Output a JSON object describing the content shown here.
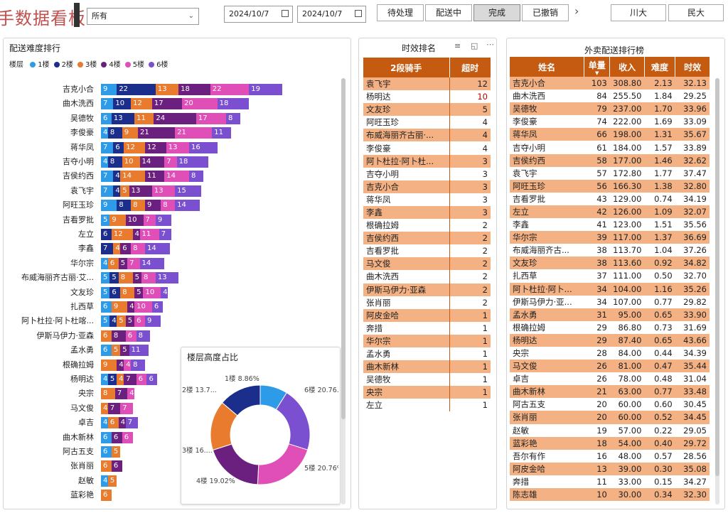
{
  "header": {
    "title": "手数据看板",
    "filter_value": "所有",
    "date_start": "2024/10/7",
    "date_end": "2024/10/7",
    "status_tabs": [
      "待处理",
      "配送中",
      "完成",
      "已撤销"
    ],
    "active_status": "完成",
    "region_tabs": [
      "川大",
      "民大"
    ]
  },
  "difficulty_panel": {
    "title": "配送难度排行",
    "legend_label": "楼层",
    "floors": [
      "1楼",
      "2楼",
      "3楼",
      "4楼",
      "5楼",
      "6楼"
    ],
    "colors": [
      "#2e9be8",
      "#1c2e8c",
      "#e87b2e",
      "#6b1f7e",
      "#e04fb8",
      "#7b50d0"
    ]
  },
  "chart_data": [
    {
      "type": "bar",
      "title": "配送难度排行",
      "stacked": true,
      "orientation": "horizontal",
      "categories": [
        "吉克小合",
        "曲木洗西",
        "吴德牧",
        "李俊豪",
        "蒋华凤",
        "吉夺小明",
        "吉侯约西",
        "袁飞宇",
        "阿旺玉珍",
        "吉看罗批",
        "左立",
        "李鑫",
        "华尔宗",
        "布威海丽齐古丽·艾...",
        "文友珍",
        "扎西草",
        "阿卜杜拉·阿卜杜喀...",
        "伊斯马伊力·亚森",
        "孟水勇",
        "根确拉姆",
        "杨明达",
        "央宗",
        "马文俊",
        "卓吉",
        "曲木新林",
        "阿古五支",
        "张肖丽",
        "赵敏",
        "蓝彩艳"
      ],
      "series": [
        {
          "name": "1楼",
          "values": [
            9,
            7,
            6,
            4,
            7,
            4,
            7,
            7,
            9,
            5,
            0,
            0,
            4,
            5,
            5,
            6,
            5,
            0,
            6,
            0,
            4,
            0,
            0,
            4,
            6,
            6,
            0,
            4,
            0
          ]
        },
        {
          "name": "2楼",
          "values": [
            22,
            10,
            13,
            8,
            6,
            8,
            4,
            4,
            8,
            0,
            6,
            7,
            0,
            5,
            6,
            0,
            4,
            0,
            0,
            0,
            5,
            0,
            0,
            0,
            0,
            0,
            0,
            0,
            0
          ]
        },
        {
          "name": "3楼",
          "values": [
            13,
            12,
            11,
            9,
            12,
            10,
            14,
            5,
            8,
            9,
            12,
            4,
            6,
            8,
            8,
            9,
            5,
            6,
            5,
            9,
            4,
            8,
            4,
            6,
            0,
            5,
            6,
            5,
            6
          ]
        },
        {
          "name": "4楼",
          "values": [
            18,
            17,
            24,
            21,
            12,
            14,
            11,
            13,
            9,
            10,
            4,
            6,
            5,
            5,
            5,
            4,
            5,
            8,
            5,
            4,
            7,
            7,
            7,
            4,
            6,
            0,
            6,
            0,
            0
          ]
        },
        {
          "name": "5楼",
          "values": [
            22,
            20,
            17,
            21,
            13,
            7,
            14,
            13,
            8,
            7,
            11,
            8,
            7,
            8,
            10,
            10,
            6,
            6,
            0,
            4,
            6,
            4,
            7,
            0,
            6,
            0,
            0,
            0,
            0
          ]
        },
        {
          "name": "6楼",
          "values": [
            19,
            18,
            8,
            11,
            16,
            18,
            8,
            15,
            14,
            9,
            7,
            14,
            14,
            13,
            4,
            6,
            9,
            8,
            11,
            8,
            6,
            0,
            0,
            7,
            0,
            0,
            0,
            0,
            0
          ]
        }
      ]
    },
    {
      "type": "pie",
      "title": "楼层高度占比",
      "categories": [
        "1楼",
        "2楼",
        "3楼",
        "4楼",
        "5楼",
        "6楼"
      ],
      "labels": [
        "1楼 8.86%",
        "2楼 13.7...",
        "3楼 16....",
        "4楼 19.02%",
        "5楼 20.76%",
        "6楼 20.76..."
      ],
      "values": [
        8.86,
        13.7,
        16.0,
        19.02,
        20.76,
        20.76
      ]
    }
  ],
  "timeliness": {
    "title": "时效排名",
    "headers": [
      "2段骑手",
      "超时"
    ],
    "rows": [
      [
        "袁飞宇",
        "12"
      ],
      [
        "杨明达",
        "10"
      ],
      [
        "文友珍",
        "5"
      ],
      [
        "阿旺玉珍",
        "4"
      ],
      [
        "布威海丽齐古丽·...",
        "4"
      ],
      [
        "李俊豪",
        "4"
      ],
      [
        "阿卜杜拉·阿卜杜...",
        "3"
      ],
      [
        "吉夺小明",
        "3"
      ],
      [
        "吉克小合",
        "3"
      ],
      [
        "蒋华凤",
        "3"
      ],
      [
        "李鑫",
        "3"
      ],
      [
        "根确拉姆",
        "2"
      ],
      [
        "吉侯约西",
        "2"
      ],
      [
        "吉看罗批",
        "2"
      ],
      [
        "马文俊",
        "2"
      ],
      [
        "曲木洗西",
        "2"
      ],
      [
        "伊斯马伊力·亚森",
        "2"
      ],
      [
        "张肖丽",
        "2"
      ],
      [
        "阿皮金哈",
        "1"
      ],
      [
        "奔措",
        "1"
      ],
      [
        "华尔宗",
        "1"
      ],
      [
        "孟水勇",
        "1"
      ],
      [
        "曲木新林",
        "1"
      ],
      [
        "吴德牧",
        "1"
      ],
      [
        "央宗",
        "1"
      ],
      [
        "左立",
        "1"
      ]
    ]
  },
  "delivery_rank": {
    "title": "外卖配送排行榜",
    "headers": [
      "姓名",
      "单量",
      "收入",
      "难度",
      "时效"
    ],
    "rows": [
      [
        "吉克小合",
        "103",
        "308.80",
        "2.13",
        "32.13"
      ],
      [
        "曲木洗西",
        "84",
        "255.50",
        "1.84",
        "29.25"
      ],
      [
        "吴德牧",
        "79",
        "237.00",
        "1.70",
        "33.96"
      ],
      [
        "李俊豪",
        "74",
        "222.00",
        "1.69",
        "33.09"
      ],
      [
        "蒋华凤",
        "66",
        "198.00",
        "1.31",
        "35.67"
      ],
      [
        "吉夺小明",
        "61",
        "184.00",
        "1.57",
        "33.89"
      ],
      [
        "吉侯约西",
        "58",
        "177.00",
        "1.46",
        "32.62"
      ],
      [
        "袁飞宇",
        "57",
        "172.80",
        "1.77",
        "37.47"
      ],
      [
        "阿旺玉珍",
        "56",
        "166.30",
        "1.38",
        "32.80"
      ],
      [
        "吉看罗批",
        "43",
        "129.00",
        "0.74",
        "34.19"
      ],
      [
        "左立",
        "42",
        "126.00",
        "1.09",
        "32.07"
      ],
      [
        "李鑫",
        "41",
        "123.00",
        "1.51",
        "35.56"
      ],
      [
        "华尔宗",
        "39",
        "117.00",
        "1.37",
        "36.69"
      ],
      [
        "布威海丽齐古...",
        "38",
        "113.70",
        "1.04",
        "37.26"
      ],
      [
        "文友珍",
        "38",
        "113.60",
        "0.92",
        "34.82"
      ],
      [
        "扎西草",
        "37",
        "111.00",
        "0.50",
        "32.70"
      ],
      [
        "阿卜杜拉·阿卜...",
        "34",
        "104.00",
        "1.16",
        "35.26"
      ],
      [
        "伊斯马伊力·亚...",
        "34",
        "107.00",
        "0.77",
        "29.82"
      ],
      [
        "孟水勇",
        "31",
        "95.00",
        "0.65",
        "33.90"
      ],
      [
        "根确拉姆",
        "29",
        "86.80",
        "0.73",
        "31.69"
      ],
      [
        "杨明达",
        "29",
        "87.40",
        "0.65",
        "43.66"
      ],
      [
        "央宗",
        "28",
        "84.00",
        "0.44",
        "34.39"
      ],
      [
        "马文俊",
        "26",
        "81.00",
        "0.47",
        "35.44"
      ],
      [
        "卓吉",
        "26",
        "78.00",
        "0.48",
        "31.04"
      ],
      [
        "曲木新林",
        "21",
        "63.00",
        "0.77",
        "33.48"
      ],
      [
        "阿古五支",
        "20",
        "60.00",
        "0.60",
        "30.45"
      ],
      [
        "张肖丽",
        "20",
        "60.00",
        "0.52",
        "34.45"
      ],
      [
        "赵敏",
        "19",
        "57.00",
        "0.22",
        "29.05"
      ],
      [
        "蓝彩艳",
        "18",
        "54.00",
        "0.40",
        "29.72"
      ],
      [
        "吾尔有作",
        "16",
        "48.00",
        "0.57",
        "28.56"
      ],
      [
        "阿皮金哈",
        "13",
        "39.00",
        "0.30",
        "35.08"
      ],
      [
        "奔措",
        "11",
        "33.00",
        "0.15",
        "34.27"
      ],
      [
        "陈志雄",
        "10",
        "30.00",
        "0.34",
        "32.30"
      ]
    ]
  }
}
